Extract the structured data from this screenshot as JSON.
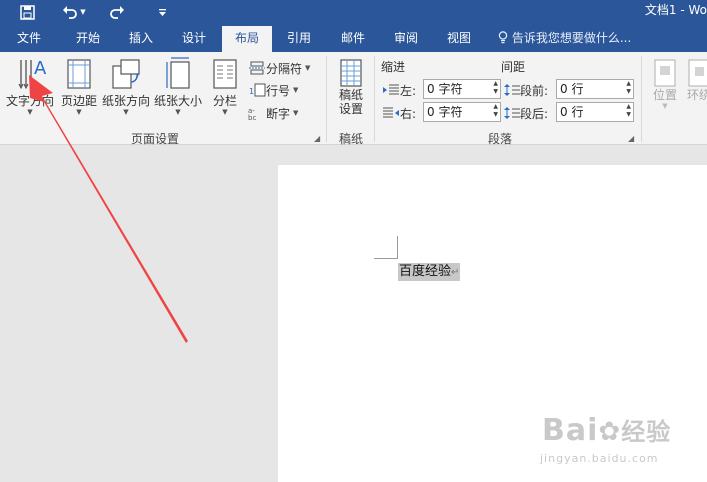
{
  "window": {
    "title": "文档1 - Wo"
  },
  "colors": {
    "accent": "#2b579a",
    "arrow": "#f04444",
    "ribbon_bg": "#f3f3f3"
  },
  "qat": {
    "save_icon": "save-icon",
    "undo_icon": "undo-icon",
    "redo_icon": "redo-icon",
    "customize_icon": "customize-qat-icon"
  },
  "tabs": [
    {
      "label": "文件"
    },
    {
      "label": "开始"
    },
    {
      "label": "插入"
    },
    {
      "label": "设计"
    },
    {
      "label": "布局",
      "active": true
    },
    {
      "label": "引用"
    },
    {
      "label": "邮件"
    },
    {
      "label": "审阅"
    },
    {
      "label": "视图"
    }
  ],
  "tell_me": "告诉我您想要做什么...",
  "ribbon": {
    "page_setup": {
      "text_direction": "文字方向",
      "margins": "页边距",
      "orientation": "纸张方向",
      "size": "纸张大小",
      "columns": "分栏",
      "breaks": "分隔符",
      "line_numbers": "行号",
      "hyphenation": "断字",
      "group_label": "页面设置"
    },
    "manuscript": {
      "settings_line1": "稿纸",
      "settings_line2": "设置",
      "group_label": "稿纸"
    },
    "paragraph": {
      "indent_label": "缩进",
      "spacing_label": "间距",
      "left_label": "左:",
      "left_value": "0 字符",
      "right_label": "右:",
      "right_value": "0 字符",
      "before_label": "段前:",
      "before_value": "0 行",
      "after_label": "段后:",
      "after_value": "0 行",
      "group_label": "段落"
    },
    "arrange": {
      "position": "位置",
      "wrap": "环绕"
    }
  },
  "document": {
    "text": "百度经验",
    "paragraph_mark": "↵"
  },
  "watermark": {
    "main": "Bai",
    "main2": "经验",
    "sub": "jingyan.baidu.com"
  }
}
